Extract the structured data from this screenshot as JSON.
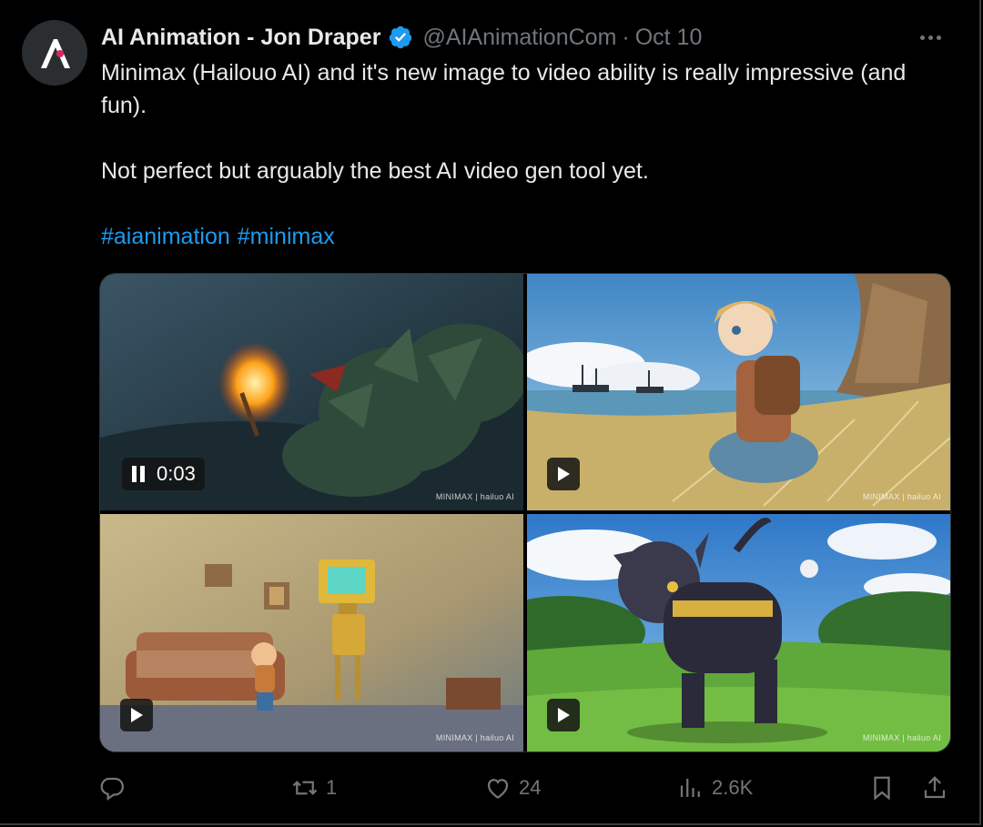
{
  "tweet": {
    "author_name": "AI Animation - Jon Draper",
    "handle": "@AIAnimationCom",
    "separator": "·",
    "date": "Oct 10",
    "line1": "Minimax (Hailouo AI) and it's new image to video ability is really impressive (and fun).",
    "line2": "Not perfect but arguably the best AI video gen tool yet.",
    "hashtags": [
      "#aianimation",
      "#minimax"
    ]
  },
  "media": {
    "video1": {
      "timer": "0:03",
      "watermark": "MINIMAX | hailuo AI"
    },
    "video2": {
      "watermark": "MINIMAX | hailuo AI"
    },
    "video3": {
      "watermark": "MINIMAX | hailuo AI"
    },
    "video4": {
      "watermark": "MINIMAX | hailuo AI"
    }
  },
  "actions": {
    "reply_count": "",
    "repost_count": "1",
    "like_count": "24",
    "views_count": "2.6K"
  },
  "colors": {
    "background": "#000000",
    "text": "#e7e9ea",
    "muted": "#71767b",
    "link": "#1d9bf0",
    "verified": "#1d9bf0"
  },
  "icons": [
    "avatar-logo-icon",
    "verified-badge-icon",
    "more-icon",
    "pause-icon",
    "play-icon",
    "reply-icon",
    "repost-icon",
    "like-icon",
    "views-icon",
    "bookmark-icon",
    "share-icon"
  ]
}
